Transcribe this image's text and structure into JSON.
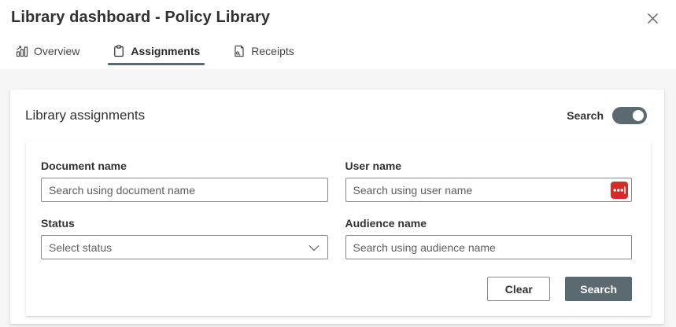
{
  "colors": {
    "accent_slate": "#5b6a70",
    "lastpass_red": "#d32d27",
    "text_primary": "#323130",
    "text_secondary": "#605e5c",
    "input_border": "#8a8886",
    "page_background": "#f5f5f5"
  },
  "header": {
    "title": "Library dashboard - Policy Library"
  },
  "tabs": [
    {
      "label": "Overview",
      "icon": "bar-chart-icon",
      "active": false
    },
    {
      "label": "Assignments",
      "icon": "clipboard-icon",
      "active": true
    },
    {
      "label": "Receipts",
      "icon": "receipt-icon",
      "active": false
    }
  ],
  "panel": {
    "title": "Library assignments",
    "search_toggle": {
      "label": "Search",
      "state": "on"
    }
  },
  "form": {
    "fields": [
      {
        "label": "Document name",
        "placeholder": "Search using document name",
        "type": "text"
      },
      {
        "label": "User name",
        "placeholder": "Search using user name",
        "type": "text",
        "lastpass_icon": true
      },
      {
        "label": "Status",
        "placeholder": "Select status",
        "type": "dropdown"
      },
      {
        "label": "Audience name",
        "placeholder": "Search using audience name",
        "type": "text"
      }
    ],
    "buttons": {
      "clear": "Clear",
      "search": "Search"
    }
  }
}
